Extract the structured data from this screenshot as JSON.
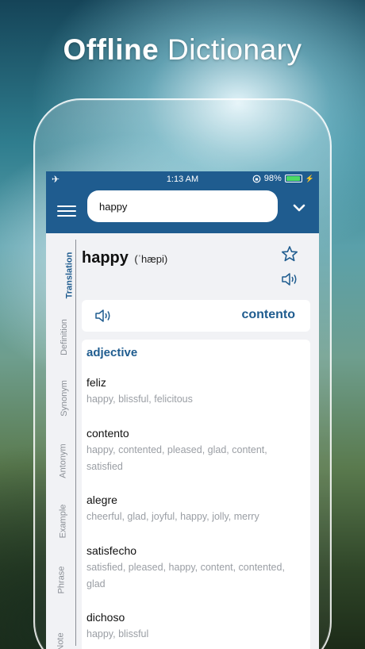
{
  "headline": {
    "bold": "Offline",
    "light": "Dictionary"
  },
  "status": {
    "time": "1:13 AM",
    "battery": "98%",
    "battery_level": 0.98
  },
  "search": {
    "value": "happy"
  },
  "tabs": [
    "Translation",
    "Definition",
    "Synonym",
    "Antonym",
    "Example",
    "Phrase",
    "Note"
  ],
  "entry": {
    "word": "happy",
    "ipa": "(ˈhæpi)"
  },
  "translation": "contento",
  "pos": "adjective",
  "results": [
    {
      "word": "feliz",
      "synonyms": "happy, blissful, felicitous"
    },
    {
      "word": "contento",
      "synonyms": "happy, contented, pleased, glad, content, satisfied"
    },
    {
      "word": "alegre",
      "synonyms": "cheerful, glad, joyful, happy, jolly, merry"
    },
    {
      "word": "satisfecho",
      "synonyms": "satisfied, pleased, happy, content, contented, glad"
    },
    {
      "word": "dichoso",
      "synonyms": "happy, blissful"
    }
  ],
  "colors": {
    "primary": "#1f5c8f",
    "muted": "#9a9ea4",
    "battery": "#4cd964"
  }
}
